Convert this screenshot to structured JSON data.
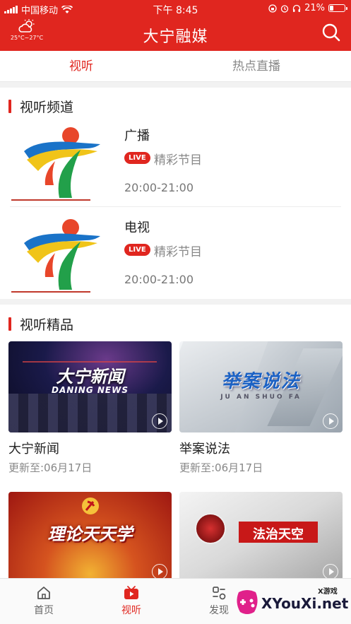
{
  "status_bar": {
    "carrier": "中国移动",
    "time": "下午 8:45",
    "battery": "21%"
  },
  "header": {
    "temperature": "25°C~27°C",
    "title": "大宁融媒",
    "weather_icon": "cloud-sun-icon",
    "search_icon": "search-icon"
  },
  "tabs": [
    {
      "label": "视听",
      "active": true
    },
    {
      "label": "热点直播",
      "active": false
    }
  ],
  "channels_section": {
    "title": "视听频道",
    "items": [
      {
        "name": "广播",
        "badge": "LIVE",
        "program": "精彩节目",
        "time": "20:00-21:00"
      },
      {
        "name": "电视",
        "badge": "LIVE",
        "program": "精彩节目",
        "time": "20:00-21:00"
      }
    ]
  },
  "featured_section": {
    "title": "视听精品",
    "items": [
      {
        "title": "大宁新闻",
        "updated": "更新至:06月17日",
        "thumb_title": "大宁新闻",
        "thumb_sub": "DANING NEWS"
      },
      {
        "title": "举案说法",
        "updated": "更新至:06月17日",
        "thumb_title": "举案说法",
        "thumb_sub": "JU AN SHUO FA"
      },
      {
        "thumb_title": "理论天天学"
      },
      {
        "thumb_title": "法治天空"
      }
    ]
  },
  "bottom_nav": [
    {
      "label": "首页",
      "icon": "home-icon",
      "active": false
    },
    {
      "label": "视听",
      "icon": "tv-play-icon",
      "active": true
    },
    {
      "label": "发现",
      "icon": "discover-icon",
      "active": false
    }
  ],
  "watermark": {
    "text": "XYouXi.net",
    "tag": "X游戏"
  },
  "colors": {
    "brand_red": "#e0261f",
    "text_gray": "#888888"
  }
}
